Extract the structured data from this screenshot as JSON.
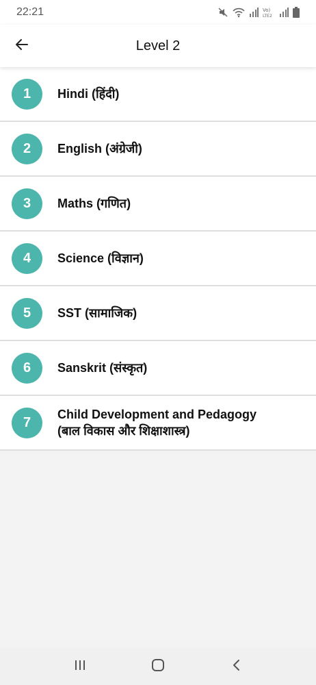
{
  "status_bar": {
    "time": "22:21",
    "icons": [
      "mute-icon",
      "wifi-icon",
      "signal-icon",
      "volte-lte2-icon",
      "signal-icon",
      "battery-icon"
    ]
  },
  "app_bar": {
    "back_icon": "arrow-left-icon",
    "title": "Level 2"
  },
  "subjects": [
    {
      "number": "1",
      "label": "Hindi (हिंदी)"
    },
    {
      "number": "2",
      "label": "English (अंग्रेजी)"
    },
    {
      "number": "3",
      "label": "Maths (गणित)"
    },
    {
      "number": "4",
      "label": "Science (विज्ञान)"
    },
    {
      "number": "5",
      "label": "SST (सामाजिक)"
    },
    {
      "number": "6",
      "label": "Sanskrit (संस्कृत)"
    },
    {
      "number": "7",
      "label": "Child Development and Pedagogy",
      "label_line2": "(बाल विकास और शिक्षाशास्त्र)"
    }
  ],
  "colors": {
    "accent": "#4db6ac",
    "background": "#f3f3f3"
  },
  "nav_bar": {
    "icons": [
      "recent-apps-icon",
      "home-icon",
      "back-icon"
    ]
  }
}
